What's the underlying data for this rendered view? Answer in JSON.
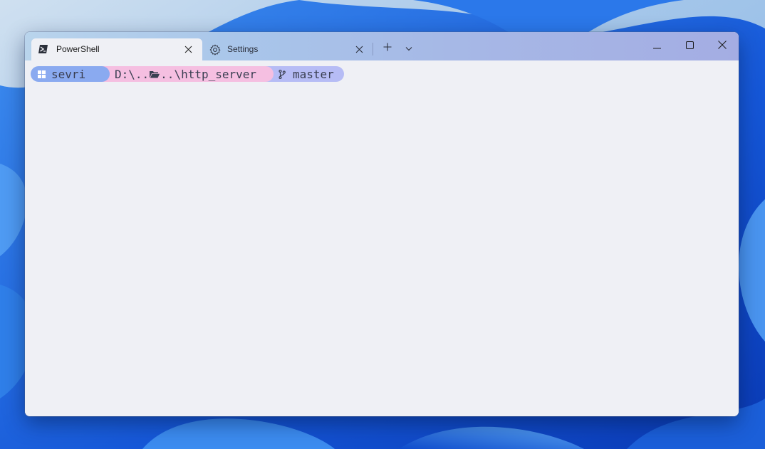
{
  "tabs": [
    {
      "label": "PowerShell",
      "icon": "powershell-icon",
      "active": true
    },
    {
      "label": "Settings",
      "icon": "gear-icon",
      "active": false
    }
  ],
  "tab_controls": {
    "new_tab_icon": "plus-icon",
    "dropdown_icon": "chevron-down-icon"
  },
  "window_controls": {
    "minimize_icon": "minimize-icon",
    "maximize_icon": "maximize-icon",
    "close_icon": "close-icon"
  },
  "prompt": {
    "user": "sevri",
    "path_prefix": "D:\\..",
    "path_suffix": "..\\http_server",
    "branch": "master"
  },
  "colors": {
    "user_segment": "#8aaaf0",
    "path_segment": "#f5bfe1",
    "git_segment": "#b6bcf5",
    "terminal_bg": "#eff0f5"
  }
}
